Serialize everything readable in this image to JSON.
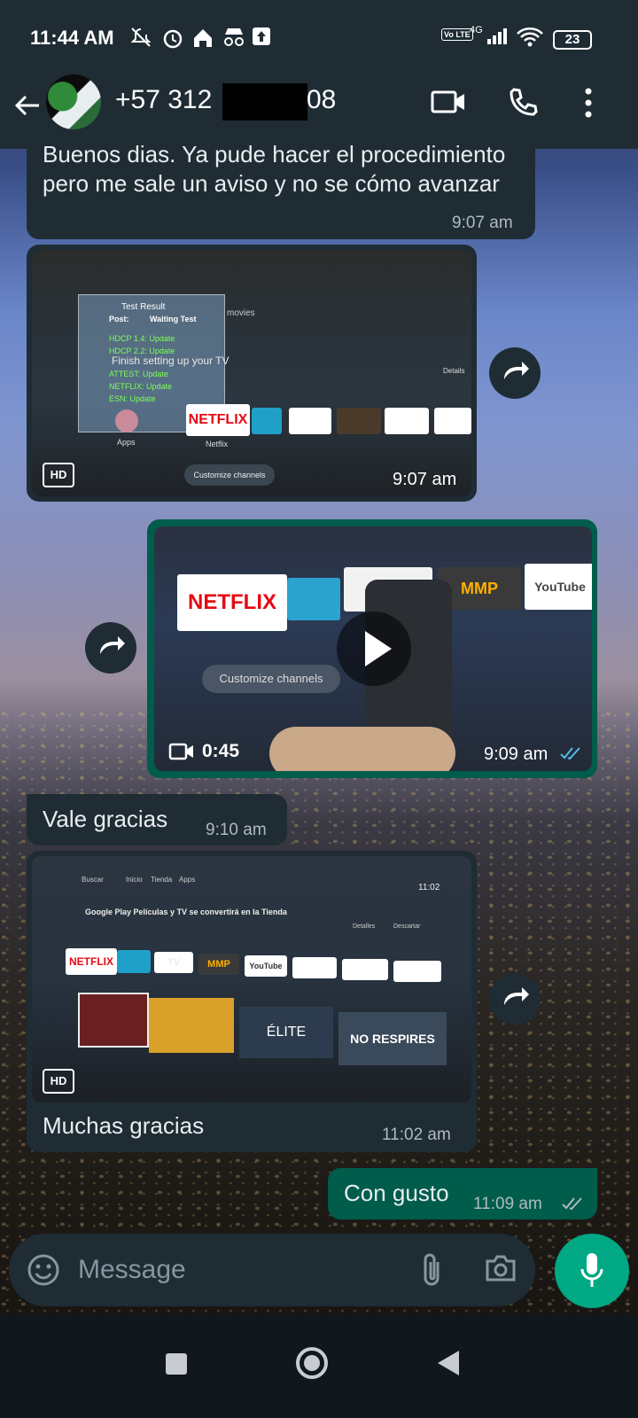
{
  "status_bar": {
    "time": "11:44 AM",
    "network": "4G",
    "volte": "Vo LTE",
    "battery": "23"
  },
  "header": {
    "contact_prefix": "+57 312",
    "contact_suffix": "08"
  },
  "messages": {
    "m1": {
      "text": "Buenos dias. Ya pude hacer el procedimiento pero me sale un aviso y no se cómo avanzar",
      "time": "9:07 am"
    },
    "m2": {
      "time": "9:07 am",
      "quality": "HD",
      "tv": {
        "test_title": "Test Result",
        "port_label": "Post:",
        "port_value": "Waiting Test",
        "rows": [
          "HDCP 1.4: Update",
          "HDCP 2.2: Update",
          "ATTEST: Update",
          "NETFLIX: Update",
          "ESN: Update"
        ],
        "finish_text": "Finish setting up your TV",
        "apps_label": "Apps",
        "netflix": "NETFLIX",
        "netflix_caption": "Netflix",
        "customize": "Customize channels",
        "details": "Details",
        "movies": "movies"
      }
    },
    "m3": {
      "duration": "0:45",
      "time": "9:09 am",
      "tv": {
        "netflix": "NETFLIX",
        "mmp": "MMP",
        "youtube": "YouTube",
        "customize": "Customize channels"
      }
    },
    "m4": {
      "text": "Vale gracias",
      "time": "9:10 am"
    },
    "m5": {
      "caption": "Muchas gracias",
      "time": "11:02 am",
      "quality": "HD",
      "tv": {
        "tabs": [
          "Buscar",
          "Inicio",
          "Tienda",
          "Apps"
        ],
        "clock": "11:02",
        "banner": "Google Play Películas y TV se convertirá en la Tienda",
        "details": "Detalles",
        "dismiss": "Descartar",
        "netflix": "NETFLIX",
        "tv": "TV",
        "mmp": "MMP",
        "youtube": "YouTube",
        "elite": "ÉLITE",
        "no_respires": "NO RESPIRES"
      }
    },
    "m6": {
      "text": "Con gusto",
      "time": "11:09 am"
    }
  },
  "composer": {
    "placeholder": "Message"
  },
  "colors": {
    "incoming": "#1f2c34",
    "outgoing": "#005c4b",
    "accent": "#00a884"
  }
}
